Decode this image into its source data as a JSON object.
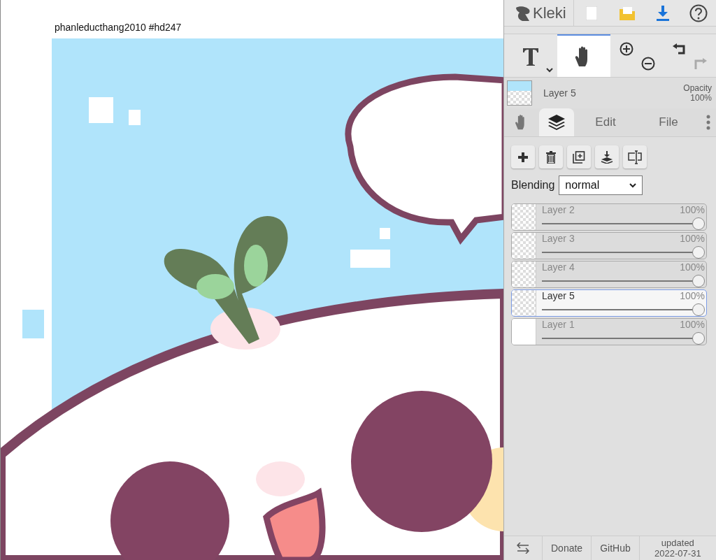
{
  "canvas": {
    "caption": "phanleducthang2010 #hd247"
  },
  "header": {
    "logo": "Kleki"
  },
  "tools": [
    {
      "kind": "text",
      "selected": false
    },
    {
      "kind": "hand",
      "selected": true
    }
  ],
  "history": {
    "undo_disabled": false,
    "redo_disabled": true
  },
  "current_layer": {
    "name": "Layer 5",
    "opacity_label": "Opacity",
    "opacity": "100%"
  },
  "tabs": [
    {
      "kind": "hand",
      "selected": false
    },
    {
      "kind": "layers",
      "selected": true
    },
    {
      "kind": "text",
      "label": "Edit",
      "selected": false
    },
    {
      "kind": "text",
      "label": "File",
      "selected": false
    },
    {
      "kind": "more",
      "selected": false
    }
  ],
  "blending": {
    "label": "Blending",
    "value": "normal"
  },
  "layers": [
    {
      "name": "Layer 2",
      "opacity": "100%",
      "level": 1,
      "selected": false,
      "kind": "checker"
    },
    {
      "name": "Layer 3",
      "opacity": "100%",
      "level": 1,
      "selected": false,
      "kind": "checker"
    },
    {
      "name": "Layer 4",
      "opacity": "100%",
      "level": 1,
      "selected": false,
      "kind": "checker"
    },
    {
      "name": "Layer 5",
      "opacity": "100%",
      "level": 1,
      "selected": true,
      "kind": "checker"
    },
    {
      "name": "Layer 1",
      "opacity": "100%",
      "level": 1,
      "selected": false,
      "kind": "white"
    }
  ],
  "footer": {
    "donate": "Donate",
    "github": "GitHub",
    "updated_label": "updated",
    "updated_date": "2022-07-31"
  }
}
